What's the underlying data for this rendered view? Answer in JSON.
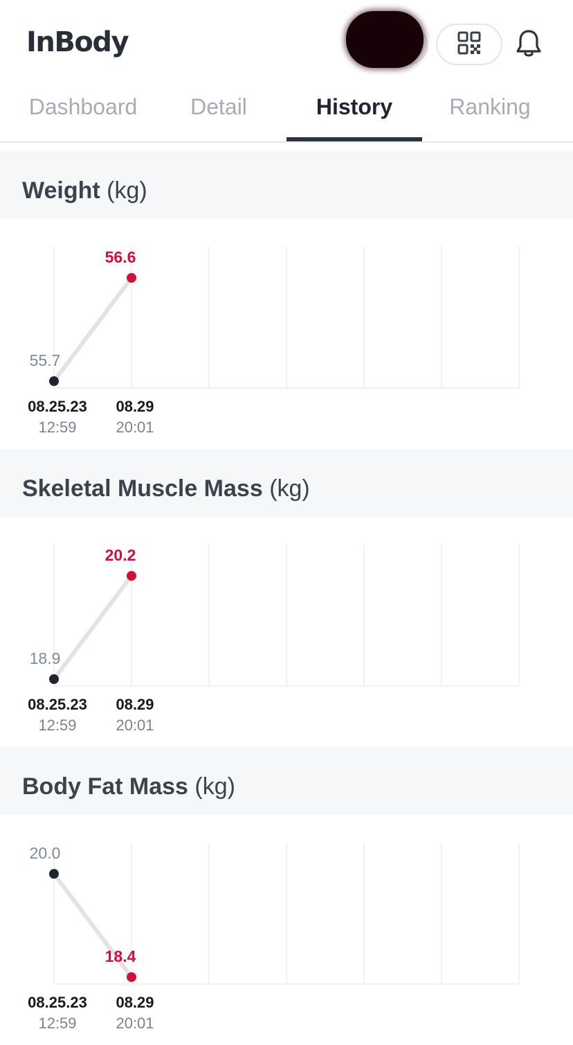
{
  "header": {
    "logo": "InBody",
    "icons": {
      "qr": "qr-code-icon",
      "bell": "bell-icon"
    }
  },
  "tabs": [
    {
      "label": "Dashboard",
      "active": false
    },
    {
      "label": "Detail",
      "active": false
    },
    {
      "label": "History",
      "active": true
    },
    {
      "label": "Ranking",
      "active": false
    }
  ],
  "colors": {
    "accent_red": "#d0103a",
    "point_dark": "#1f2430",
    "old_value_label": "#7e8a9c",
    "line": "#e3e3e3",
    "grid": "#eeeeee"
  },
  "sections": [
    {
      "title": "Weight",
      "unit": "(kg)",
      "chart_data": {
        "type": "line",
        "x": [
          "08.25.23 12:59",
          "08.29 20:01"
        ],
        "x_date_labels": [
          "08.25.23",
          "08.29"
        ],
        "x_time_labels": [
          "12:59",
          "20:01"
        ],
        "values": [
          55.7,
          56.6
        ],
        "value_labels": [
          "55.7",
          "56.6"
        ],
        "grid": true
      }
    },
    {
      "title": "Skeletal Muscle Mass",
      "unit": "(kg)",
      "chart_data": {
        "type": "line",
        "x": [
          "08.25.23 12:59",
          "08.29 20:01"
        ],
        "x_date_labels": [
          "08.25.23",
          "08.29"
        ],
        "x_time_labels": [
          "12:59",
          "20:01"
        ],
        "values": [
          18.9,
          20.2
        ],
        "value_labels": [
          "18.9",
          "20.2"
        ],
        "grid": true
      }
    },
    {
      "title": "Body Fat Mass",
      "unit": "(kg)",
      "chart_data": {
        "type": "line",
        "x": [
          "08.25.23 12:59",
          "08.29 20:01"
        ],
        "x_date_labels": [
          "08.25.23",
          "08.29"
        ],
        "x_time_labels": [
          "12:59",
          "20:01"
        ],
        "values": [
          20.0,
          18.4
        ],
        "value_labels": [
          "20.0",
          "18.4"
        ],
        "grid": true
      }
    }
  ]
}
